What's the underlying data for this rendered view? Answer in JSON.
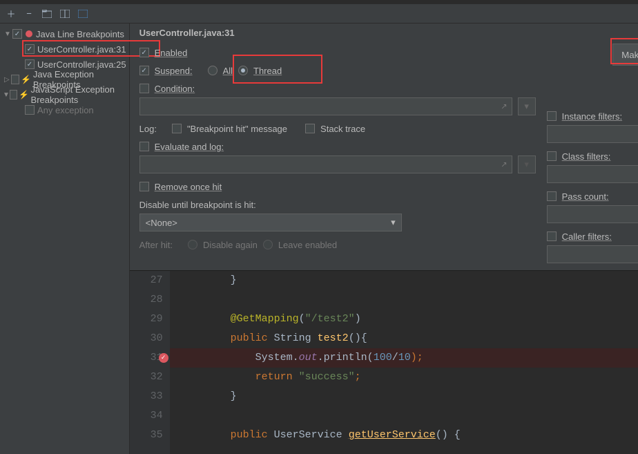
{
  "tree": {
    "group_java_line": "Java Line Breakpoints",
    "item_uc31": "UserController.java:31",
    "item_uc25": "UserController.java:25",
    "group_java_ex": "Java Exception Breakpoints",
    "group_js_ex": "JavaScript Exception Breakpoints",
    "item_any_ex": "Any exception"
  },
  "detail": {
    "title": "UserController.java:31",
    "enabled": "Enabled",
    "suspend": "Suspend:",
    "all": "All",
    "thread": "Thread",
    "make_default": "Make Default",
    "condition": "Condition:",
    "log": "Log:",
    "bp_hit_msg": "\"Breakpoint hit\" message",
    "stack_trace": "Stack trace",
    "eval_log": "Evaluate and log:",
    "remove_once": "Remove once hit",
    "disable_until": "Disable until breakpoint is hit:",
    "none": "<None>",
    "after_hit": "After hit:",
    "disable_again": "Disable again",
    "leave_enabled": "Leave enabled",
    "instance_filters": "Instance filters:",
    "class_filters": "Class filters:",
    "pass_count": "Pass count:",
    "caller_filters": "Caller filters:",
    "more": "..."
  },
  "code": {
    "lines": {
      "27": "        }",
      "28": "",
      "29_a": "        @GetMapping",
      "29_b": "\"/test2\"",
      "30_a": "        public ",
      "30_b": "String ",
      "30_c": "test2",
      "30_d": "(){",
      "31_a": "            System.",
      "31_b": "out",
      "31_c": ".println(",
      "31_d": "100",
      "31_e": "/",
      "31_f": "10",
      "31_g": ");",
      "32_a": "            return ",
      "32_b": "\"success\"",
      "32_c": ";",
      "33": "        }",
      "34": "",
      "35_a": "        public ",
      "35_b": "UserService ",
      "35_c": "getUserService",
      "35_d": "() {"
    },
    "gutter": [
      "27",
      "28",
      "29",
      "30",
      "31",
      "32",
      "33",
      "34",
      "35"
    ]
  }
}
